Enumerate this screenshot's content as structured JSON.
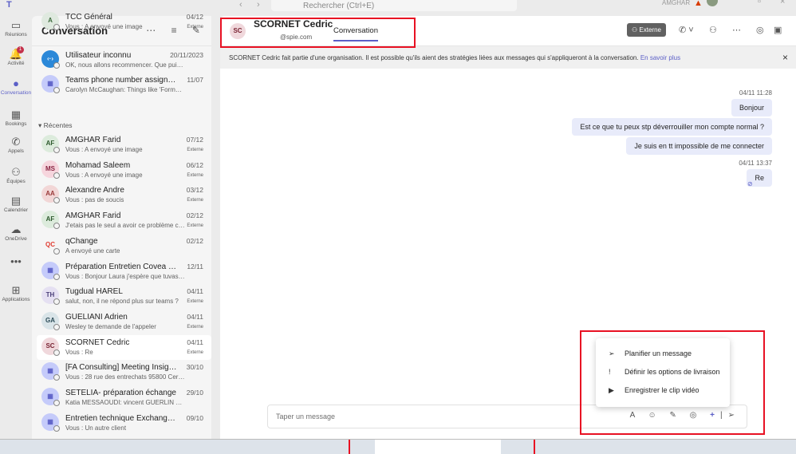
{
  "topbar": {
    "search_placeholder": "Rechercher (Ctrl+E)",
    "user": "AMGHAR"
  },
  "rail": [
    {
      "label": "Réunions",
      "icon": "video-icon",
      "glyph": "▭"
    },
    {
      "label": "Activité",
      "icon": "bell-icon",
      "glyph": "🔔",
      "badge": "1"
    },
    {
      "label": "Conversation",
      "icon": "chat-icon",
      "glyph": "●",
      "active": true
    },
    {
      "label": "Bookings",
      "icon": "bookings-icon",
      "glyph": "▦"
    },
    {
      "label": "Appels",
      "icon": "phone-icon",
      "glyph": "✆"
    },
    {
      "label": "Équipes",
      "icon": "teams-icon",
      "glyph": "⚇"
    },
    {
      "label": "Calendrier",
      "icon": "calendar-icon",
      "glyph": "▤"
    },
    {
      "label": "OneDrive",
      "icon": "cloud-icon",
      "glyph": "☁"
    },
    {
      "label": "",
      "icon": "more-icon",
      "glyph": "•••"
    },
    {
      "label": "Applications",
      "icon": "add-apps-icon",
      "glyph": "⊞"
    }
  ],
  "list": {
    "title": "Conversation",
    "section": "Récentes",
    "pinned": [
      {
        "name": "TCC Général",
        "preview": "Vous : A envoyé une image",
        "date": "04/12",
        "ext": "Externe",
        "initials": "A",
        "bg": "#dfe9df",
        "fg": "#3d6b3d"
      },
      {
        "name": "Utilisateur inconnu",
        "preview": "OK, nous allons recommencer. Que puis-je fair...",
        "date": "20/11/2023",
        "ext": "",
        "initials": "‹·›",
        "bg": "#2b88d8",
        "fg": "#fff"
      },
      {
        "name": "Teams phone number assignment...",
        "preview": "Carolyn McCaughan: Things like 'Formerly Bill S...",
        "date": "11/07",
        "ext": "",
        "initials": "▦",
        "bg": "#c5cbfa",
        "fg": "#5b5fc7"
      }
    ],
    "recent": [
      {
        "name": "AMGHAR Farid",
        "preview": "Vous : A envoyé une image",
        "date": "07/12",
        "ext": "Externe",
        "initials": "AF",
        "bg": "#dcebdc",
        "fg": "#2d5a2d"
      },
      {
        "name": "Mohamad Saleem",
        "preview": "Vous : A envoyé une image",
        "date": "06/12",
        "ext": "Externe",
        "initials": "MS",
        "bg": "#f6d5dd",
        "fg": "#8a2542"
      },
      {
        "name": "Alexandre Andre",
        "preview": "Vous : pas de soucis",
        "date": "03/12",
        "ext": "Externe",
        "initials": "AA",
        "bg": "#f2d6d6",
        "fg": "#9a3a3a"
      },
      {
        "name": "AMGHAR Farid",
        "preview": "J'etais pas le seul a avoir ce problème ce ...",
        "date": "02/12",
        "ext": "Externe",
        "initials": "AF",
        "bg": "#dcebdc",
        "fg": "#2d5a2d"
      },
      {
        "name": "qChange",
        "preview": "A envoyé une carte",
        "date": "02/12",
        "ext": "",
        "initials": "QC",
        "bg": "#f5f5f5",
        "fg": "#e03c31"
      },
      {
        "name": "Préparation Entretien Covea - Che...",
        "preview": "Vous : Bonjour Laura j'espère que tuvas bien?",
        "date": "12/11",
        "ext": "",
        "initials": "▦",
        "bg": "#c5cbfa",
        "fg": "#5b5fc7"
      },
      {
        "name": "Tugdual HAREL",
        "preview": "salut, non, il ne répond plus sur teams ?",
        "date": "04/11",
        "ext": "Externe",
        "initials": "TH",
        "bg": "#e5e0f2",
        "fg": "#4b3f7a"
      },
      {
        "name": "GUELIANI Adrien",
        "preview": "Wesley te demande de l'appeler",
        "date": "04/11",
        "ext": "Externe",
        "initials": "GA",
        "bg": "#d9e4e8",
        "fg": "#2c4c58"
      },
      {
        "name": "SCORNET Cedric",
        "preview": "Vous : Re",
        "date": "04/11",
        "ext": "Externe",
        "initials": "SC",
        "bg": "#f0d8dc",
        "fg": "#7a2434",
        "selected": true
      },
      {
        "name": "[FA Consulting] Meeting Insights ...",
        "preview": "Vous : 28 rue des entrechats 95800 Cergy France",
        "date": "30/10",
        "ext": "",
        "initials": "▦",
        "bg": "#c5cbfa",
        "fg": "#5b5fc7"
      },
      {
        "name": "SETELIA- préparation échange",
        "preview": "Katia MESSAOUDI: vincent GUERLIN 06 85 61 9...",
        "date": "29/10",
        "ext": "",
        "initials": "▦",
        "bg": "#c5cbfa",
        "fg": "#5b5fc7"
      },
      {
        "name": "Entretien technique Exchange Fari...",
        "preview": "Vous : Un autre client",
        "date": "09/10",
        "ext": "",
        "initials": "▦",
        "bg": "#c5cbfa",
        "fg": "#5b5fc7"
      }
    ]
  },
  "chat": {
    "initials": "SC",
    "name": "SCORNET Cedric",
    "email": "@spie.com",
    "tab": "Conversation",
    "externe": "Externe",
    "banner": "SCORNET Cedric fait partie d'une organisation. Il est possible qu'ils aient des stratégies liées aux messages qui s'appliqueront à la conversation.",
    "banner_link": "En savoir plus",
    "groups": [
      {
        "time": "04/11 11:28",
        "messages": [
          "Bonjour",
          "Est ce que tu peux stp déverrouiller mon compte normal ?",
          "Je suis en tt impossible de me connecter"
        ]
      },
      {
        "time": "04/11 13:37",
        "messages": [
          "Re"
        ]
      }
    ],
    "compose_placeholder": "Taper un message",
    "menu": [
      "Planifier un message",
      "Définir les options de livraison",
      "Enregistrer le clip vidéo"
    ]
  },
  "colors": {
    "accent": "#5b5fc7",
    "highlight": "#e81123"
  }
}
